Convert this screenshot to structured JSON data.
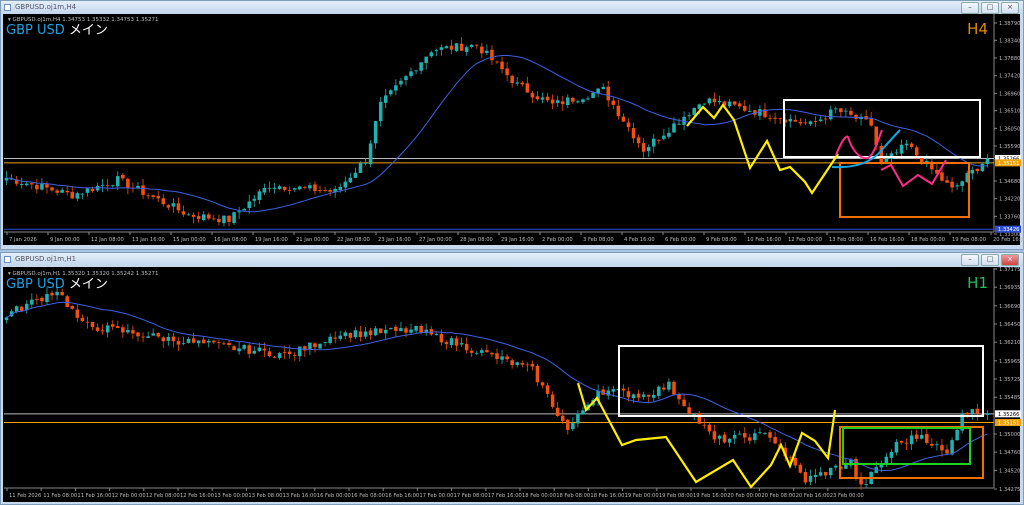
{
  "top": {
    "window_title": "GBPUSD.oj1m,H4",
    "info_line": "GBPUSD.oj1m,H4  1.34753 1.35332 1.34753 1.35271",
    "symbol_label": "GBP USD",
    "symbol_suffix": "メイン",
    "timeframe": "H4",
    "timeframe_color": "#e08a00",
    "price_ticks": [
      "1.38790",
      "1.38340",
      "1.37880",
      "1.37420",
      "1.36960",
      "1.36510",
      "1.36050",
      "1.35590",
      "1.34680",
      "1.34220",
      "1.33760",
      "1.33300"
    ],
    "price_tick_values": [
      1.3879,
      1.3834,
      1.3788,
      1.3742,
      1.3696,
      1.3651,
      1.3605,
      1.3559,
      1.3468,
      1.3422,
      1.3376,
      1.333
    ],
    "level_labels": [
      {
        "text": "1.35266",
        "value": 1.35266,
        "color": "#ffffff"
      },
      {
        "text": "1.35151",
        "value": 1.35151,
        "color": "#f0a000"
      },
      {
        "text": "1.33426",
        "value": 1.33426,
        "color": "#3050d0"
      }
    ],
    "time_labels": [
      "7 Jan 2026",
      "9 Jan 00:00",
      "12 Jan 08:00",
      "13 Jan 16:00",
      "15 Jan 00:00",
      "16 Jan 08:00",
      "19 Jan 16:00",
      "21 Jan 00:00",
      "22 Jan 08:00",
      "23 Jan 16:00",
      "27 Jan 00:00",
      "28 Jan 08:00",
      "29 Jan 16:00",
      "2 Feb 00:00",
      "3 Feb 08:00",
      "4 Feb 16:00",
      "6 Feb 00:00",
      "9 Feb 08:00",
      "10 Feb 16:00",
      "12 Feb 00:00",
      "13 Feb 08:00",
      "16 Feb 16:00",
      "18 Feb 00:00",
      "19 Feb 08:00",
      "20 Feb 16:00"
    ],
    "bars": 195,
    "price_path": [
      [
        0,
        1.3476
      ],
      [
        13,
        1.3432
      ],
      [
        22,
        1.3471
      ],
      [
        36,
        1.338
      ],
      [
        44,
        1.3367
      ],
      [
        52,
        1.3458
      ],
      [
        65,
        1.344
      ],
      [
        71,
        1.3523
      ],
      [
        74,
        1.3666
      ],
      [
        84,
        1.3809
      ],
      [
        93,
        1.3822
      ],
      [
        101,
        1.3718
      ],
      [
        108,
        1.3666
      ],
      [
        118,
        1.3705
      ],
      [
        126,
        1.355
      ],
      [
        138,
        1.368
      ],
      [
        147,
        1.3653
      ],
      [
        159,
        1.3614
      ],
      [
        164,
        1.3653
      ],
      [
        171,
        1.3614
      ],
      [
        173,
        1.351
      ],
      [
        178,
        1.3562
      ],
      [
        187,
        1.3445
      ],
      [
        194,
        1.3527
      ]
    ]
  },
  "bottom": {
    "window_title": "GBPUSD.oj1m,H1",
    "info_line": "GBPUSD.oj1m,H1  1.35320 1.35320 1.35242 1.35271",
    "symbol_label": "GBP USD",
    "symbol_suffix": "メイン",
    "timeframe": "H1",
    "timeframe_color": "#20c060",
    "price_ticks": [
      "1.37175",
      "1.36935",
      "1.36690",
      "1.36450",
      "1.36210",
      "1.35965",
      "1.35725",
      "1.35485",
      "1.35000",
      "1.34760",
      "1.34520",
      "1.34275"
    ],
    "price_tick_values": [
      1.37175,
      1.36935,
      1.3669,
      1.3645,
      1.3621,
      1.35965,
      1.35725,
      1.35485,
      1.35,
      1.3476,
      1.3452,
      1.34275
    ],
    "level_labels": [
      {
        "text": "1.35266",
        "value": 1.35266,
        "color": "#ffffff"
      },
      {
        "text": "1.35151",
        "value": 1.35151,
        "color": "#f0a000"
      }
    ],
    "time_labels": [
      "11 Feb 2026",
      "11 Feb 08:00",
      "11 Feb 16:00",
      "12 Feb 00:00",
      "12 Feb 08:00",
      "12 Feb 16:00",
      "13 Feb 00:00",
      "13 Feb 08:00",
      "13 Feb 16:00",
      "16 Feb 00:00",
      "16 Feb 08:00",
      "16 Feb 16:00",
      "17 Feb 00:00",
      "17 Feb 08:00",
      "17 Feb 16:00",
      "18 Feb 00:00",
      "18 Feb 08:00",
      "18 Feb 16:00",
      "19 Feb 00:00",
      "19 Feb 08:00",
      "19 Feb 16:00",
      "20 Feb 00:00",
      "20 Feb 08:00",
      "20 Feb 16:00",
      "23 Feb 00:00"
    ],
    "bars": 195,
    "price_path": [
      [
        0,
        1.3657
      ],
      [
        10,
        1.369
      ],
      [
        15,
        1.3644
      ],
      [
        33,
        1.3624
      ],
      [
        56,
        1.3604
      ],
      [
        65,
        1.3631
      ],
      [
        81,
        1.3637
      ],
      [
        90,
        1.3617
      ],
      [
        104,
        1.3584
      ],
      [
        111,
        1.3505
      ],
      [
        117,
        1.3558
      ],
      [
        126,
        1.3551
      ],
      [
        131,
        1.3564
      ],
      [
        140,
        1.3492
      ],
      [
        151,
        1.3499
      ],
      [
        158,
        1.3439
      ],
      [
        167,
        1.3463
      ],
      [
        169,
        1.3429
      ],
      [
        176,
        1.3486
      ],
      [
        181,
        1.3499
      ],
      [
        186,
        1.3472
      ],
      [
        189,
        1.3529
      ]
    ]
  },
  "colors": {
    "bull": "#20b0b0",
    "bear": "#f05010",
    "ma": "#4060e0"
  }
}
